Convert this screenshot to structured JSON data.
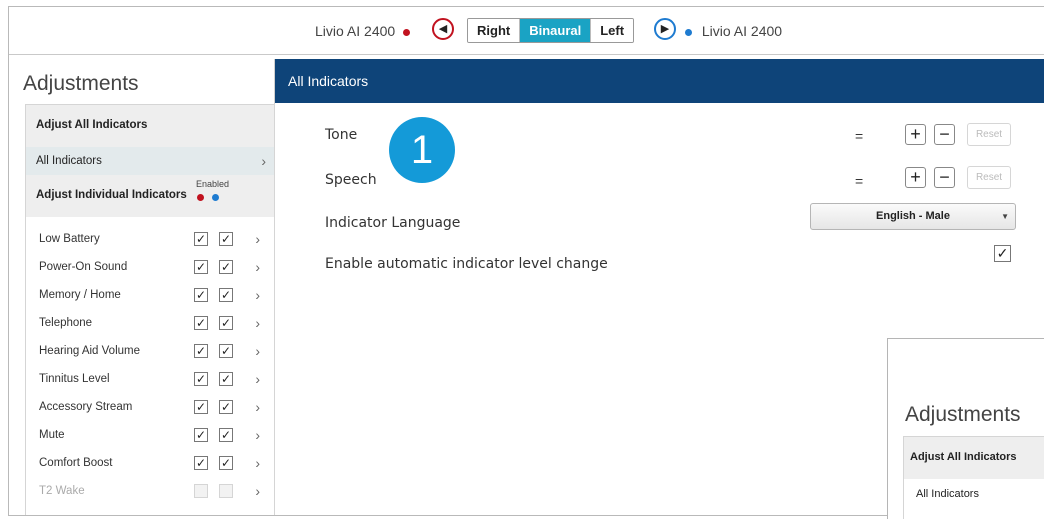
{
  "topbar": {
    "left_device": "Livio AI 2400",
    "right_device": "Livio AI 2400",
    "segments": [
      "Right",
      "Binaural",
      "Left"
    ],
    "active_segment": "Binaural",
    "left_color": "#c1121f",
    "right_color": "#1e7bd0"
  },
  "sidebar": {
    "title": "Adjustments",
    "section_all": "Adjust All Indicators",
    "selected_item": "All Indicators",
    "section_individual": "Adjust Individual Indicators",
    "enabled_label": "Enabled",
    "indicators": [
      {
        "label": "Low Battery",
        "left": true,
        "right": true,
        "disabled": false
      },
      {
        "label": "Power-On Sound",
        "left": true,
        "right": true,
        "disabled": false
      },
      {
        "label": "Memory / Home",
        "left": true,
        "right": true,
        "disabled": false
      },
      {
        "label": "Telephone",
        "left": true,
        "right": true,
        "disabled": false
      },
      {
        "label": "Hearing Aid Volume",
        "left": true,
        "right": true,
        "disabled": false
      },
      {
        "label": "Tinnitus Level",
        "left": true,
        "right": true,
        "disabled": false
      },
      {
        "label": "Accessory Stream",
        "left": true,
        "right": true,
        "disabled": false
      },
      {
        "label": "Mute",
        "left": true,
        "right": true,
        "disabled": false
      },
      {
        "label": "Comfort Boost",
        "left": true,
        "right": true,
        "disabled": false
      },
      {
        "label": "T2 Wake",
        "left": false,
        "right": false,
        "disabled": true
      }
    ]
  },
  "main": {
    "header": "All Indicators",
    "tone_label": "Tone",
    "speech_label": "Speech",
    "eq_symbol": "=",
    "plus": "+",
    "minus": "−",
    "reset_label": "Reset",
    "language_label": "Indicator Language",
    "language_value": "English - Male",
    "auto_label": "Enable automatic indicator level change",
    "auto_checked": true,
    "badge": "1",
    "accent": "#0e4479",
    "badge_color": "#149ad8"
  },
  "inset": {
    "title": "Adjustments",
    "section_all": "Adjust All Indicators",
    "item": "All Indicators"
  }
}
